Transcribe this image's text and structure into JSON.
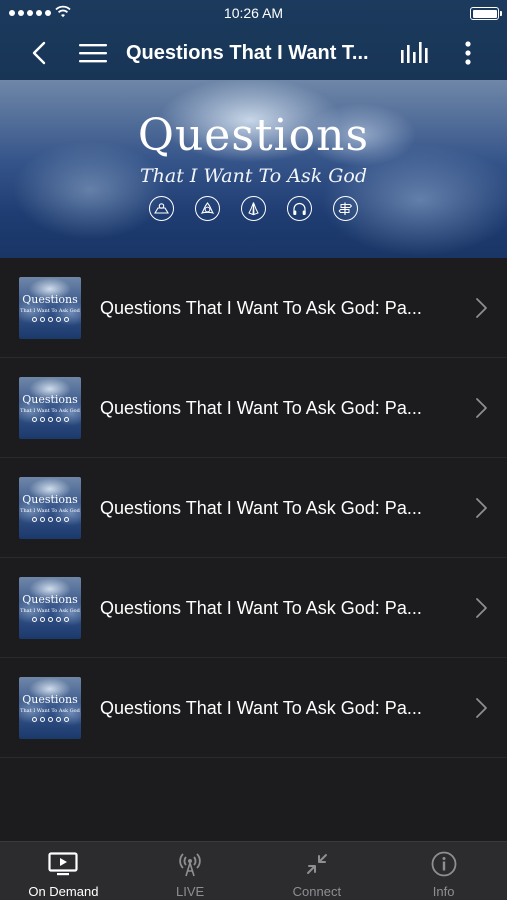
{
  "status_bar": {
    "time": "10:26 AM"
  },
  "nav": {
    "title": "Questions That I Want T..."
  },
  "banner": {
    "title": "Questions",
    "subtitle": "That I Want To Ask God",
    "icons": [
      "map-icon",
      "trinity-icon",
      "praying-hands-icon",
      "headphones-icon",
      "signpost-icon"
    ]
  },
  "thumbnail": {
    "title": "Questions",
    "subtitle": "That I Want To Ask God"
  },
  "episodes": [
    {
      "label": "Questions That I Want To Ask God: Pa..."
    },
    {
      "label": "Questions That I Want To Ask God: Pa..."
    },
    {
      "label": "Questions That I Want To Ask God: Pa..."
    },
    {
      "label": "Questions That I Want To Ask God: Pa..."
    },
    {
      "label": "Questions That I Want To Ask God: Pa..."
    }
  ],
  "tabs": [
    {
      "label": "On Demand",
      "icon": "tv-play-icon",
      "active": true
    },
    {
      "label": "LIVE",
      "icon": "broadcast-icon",
      "active": false
    },
    {
      "label": "Connect",
      "icon": "connect-arrows-icon",
      "active": false
    },
    {
      "label": "Info",
      "icon": "info-icon",
      "active": false
    }
  ],
  "colors": {
    "header": "#1b3a5d",
    "background": "#1c1c1e",
    "tabbar": "#2c2c2e",
    "inactive_tab": "#8e8e93"
  }
}
